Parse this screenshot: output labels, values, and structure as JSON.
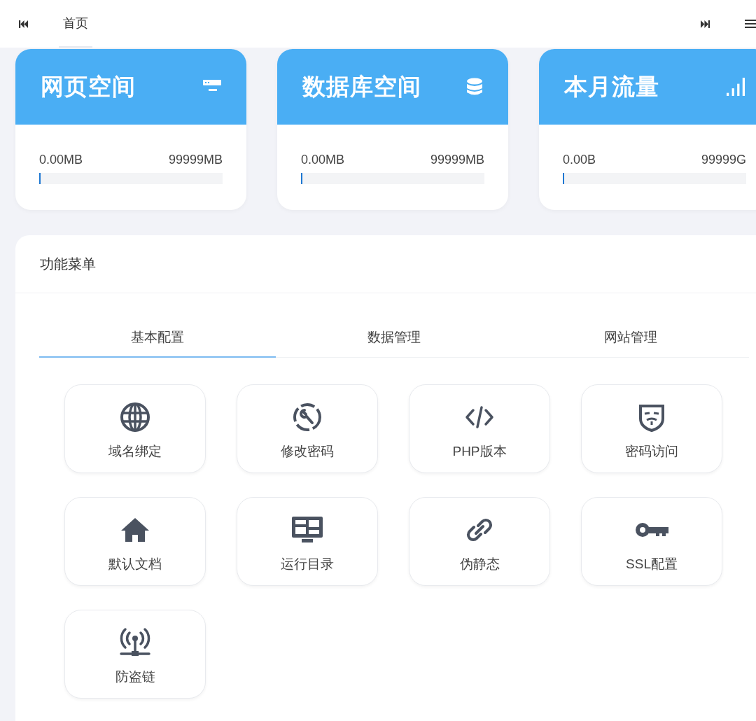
{
  "top_bar": {
    "tabs": [
      {
        "label": "首页",
        "selected": true
      }
    ]
  },
  "stats": [
    {
      "title": "网页空间",
      "kind": "server",
      "used": "0.00MB",
      "total": "99999MB",
      "level": 0
    },
    {
      "title": "数据库空间",
      "kind": "database",
      "used": "0.00MB",
      "total": "99999MB",
      "level": 0
    },
    {
      "title": "本月流量",
      "kind": "signal",
      "used": "0.00B",
      "total": "99999G",
      "level": 0
    }
  ],
  "menu": {
    "title": "功能菜单",
    "tabs": [
      {
        "label": "基本配置",
        "selected": true
      },
      {
        "label": "数据管理",
        "selected": false
      },
      {
        "label": "网站管理",
        "selected": false
      }
    ],
    "items": [
      {
        "label": "域名绑定",
        "kind": "globe"
      },
      {
        "label": "修改密码",
        "kind": "wrench"
      },
      {
        "label": "PHP版本",
        "kind": "code"
      },
      {
        "label": "密码访问",
        "kind": "mask"
      },
      {
        "label": "默认文档",
        "kind": "home"
      },
      {
        "label": "运行目录",
        "kind": "monitor"
      },
      {
        "label": "伪静态",
        "kind": "link"
      },
      {
        "label": "SSL配置",
        "kind": "key"
      },
      {
        "label": "防盗链",
        "kind": "antenna"
      }
    ]
  }
}
